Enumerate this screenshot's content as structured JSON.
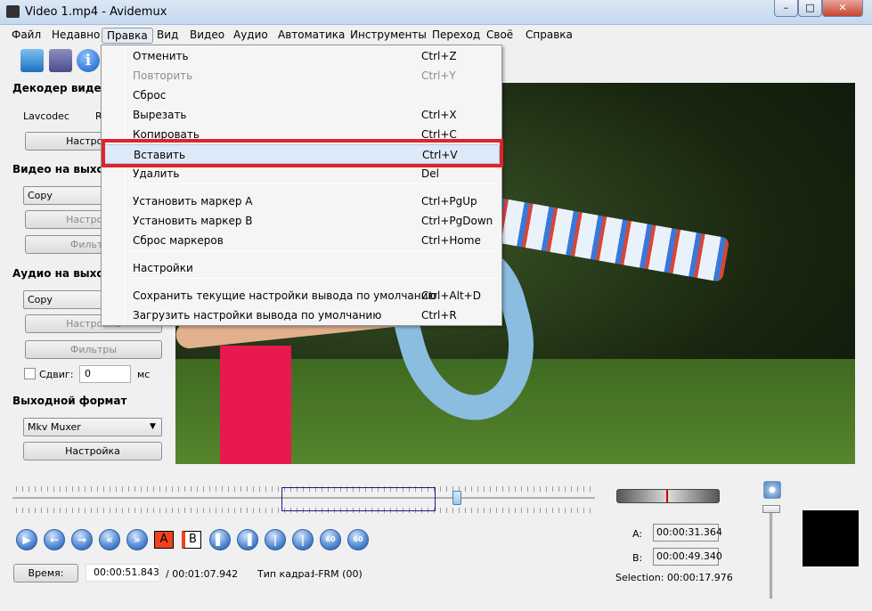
{
  "window": {
    "title": "Video 1.mp4 - Avidemux",
    "min": "–",
    "max": "□",
    "close": "✕"
  },
  "menubar": [
    "Файл",
    "Недавно",
    "Правка",
    "Вид",
    "Видео",
    "Аудио",
    "Автоматика",
    "Инструменты",
    "Переход",
    "Своё",
    "Справка"
  ],
  "edit_menu": [
    {
      "label": "Отменить",
      "shortcut": "Ctrl+Z",
      "enabled": true
    },
    {
      "label": "Повторить",
      "shortcut": "Ctrl+Y",
      "enabled": false
    },
    {
      "label": "Сброс",
      "shortcut": "",
      "enabled": true
    },
    {
      "label": "Вырезать",
      "shortcut": "Ctrl+X",
      "enabled": true
    },
    {
      "label": "Копировать",
      "shortcut": "Ctrl+C",
      "enabled": true
    },
    {
      "label": "Вставить",
      "shortcut": "Ctrl+V",
      "enabled": true,
      "highlighted": true
    },
    {
      "label": "Удалить",
      "shortcut": "Del",
      "enabled": true
    },
    {
      "label": "Установить маркер A",
      "shortcut": "Ctrl+PgUp",
      "enabled": true
    },
    {
      "label": "Установить маркер B",
      "shortcut": "Ctrl+PgDown",
      "enabled": true
    },
    {
      "label": "Сброс маркеров",
      "shortcut": "Ctrl+Home",
      "enabled": true
    },
    {
      "label": "Настройки",
      "shortcut": "",
      "enabled": true
    },
    {
      "label": "Сохранить текущие настройки вывода по умолчанию",
      "shortcut": "Ctrl+Alt+D",
      "enabled": true
    },
    {
      "label": "Загрузить настройки вывода по умолчанию",
      "shortcut": "Ctrl+R",
      "enabled": true
    }
  ],
  "left": {
    "video_decoder": "Декодер видео",
    "decoder": "Lavcodec",
    "decoder_extra": "R",
    "decoder_config": "Настройка",
    "video_output": "Видео на выходе",
    "video_codec": "Copy",
    "video_config": "Настройка",
    "video_filters": "Фильтры",
    "audio_output": "Аудио на выходе",
    "audio_codec": "Copy",
    "audio_config": "Настройка",
    "audio_filters": "Фильтры",
    "shift_label": "Сдвиг:",
    "shift_value": "0",
    "shift_unit": "мс",
    "output_format": "Выходной формат",
    "muxer": "Mkv Muxer",
    "muxer_config": "Настройка"
  },
  "transport": {
    "marker_a": "A",
    "marker_b": "B",
    "go60": "60"
  },
  "status": {
    "time_button": "Время:",
    "current_time": "00:00:51.843",
    "total_time": "/ 00:01:07.942",
    "frame_type_label": "Тип кадра:",
    "frame_type": "I-FRM (00)"
  },
  "selection": {
    "a_label": "A:",
    "a_value": "00:00:31.364",
    "b_label": "B:",
    "b_value": "00:00:49.340",
    "selection": "Selection: 00:00:17.976"
  },
  "timeline": {
    "position": 0.763,
    "selection_start": 0.462,
    "selection_end": 0.726
  }
}
